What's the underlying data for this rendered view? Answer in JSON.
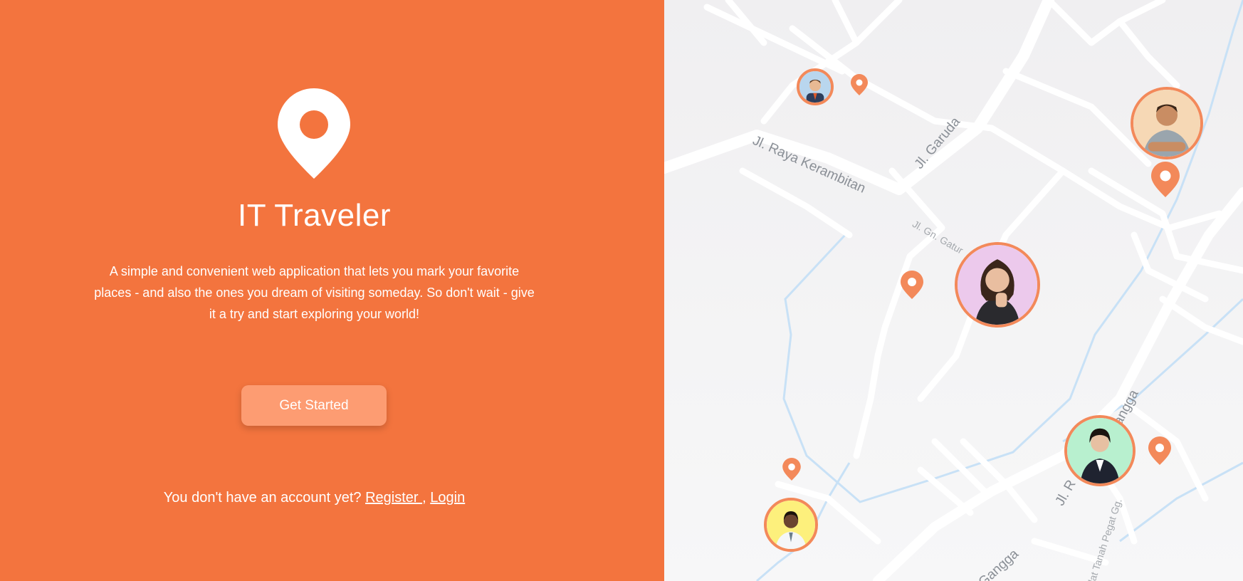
{
  "hero": {
    "title": "IT Traveler",
    "description": "A simple and convenient web application that lets you mark your favorite places - and also the ones you dream of visiting someday. So don't wait - give it a try and start exploring your world!",
    "cta_label": "Get Started",
    "account_prompt": "You don't have an account yet?",
    "register_label": "Register ",
    "separator": ",",
    "login_label": "Login",
    "logo_icon": "location-pin-icon"
  },
  "map": {
    "road_labels": [
      "Jl. Raya Kerambitan",
      "Jl. Garuda",
      "Jl. Gn. Gatur",
      "Jl. R",
      "angga",
      "Gangga",
      "lat Tanah Pegat Gg."
    ],
    "avatars": [
      "man-in-suit",
      "man-arms-crossed",
      "woman-thinking",
      "woman-in-suit",
      "doctor"
    ],
    "pin_icon": "map-pin-icon"
  },
  "colors": {
    "accent": "#f3743e",
    "button": "#fd9c72",
    "avatar_ring": "#f3895a",
    "map_background": "#f2f2f3"
  }
}
